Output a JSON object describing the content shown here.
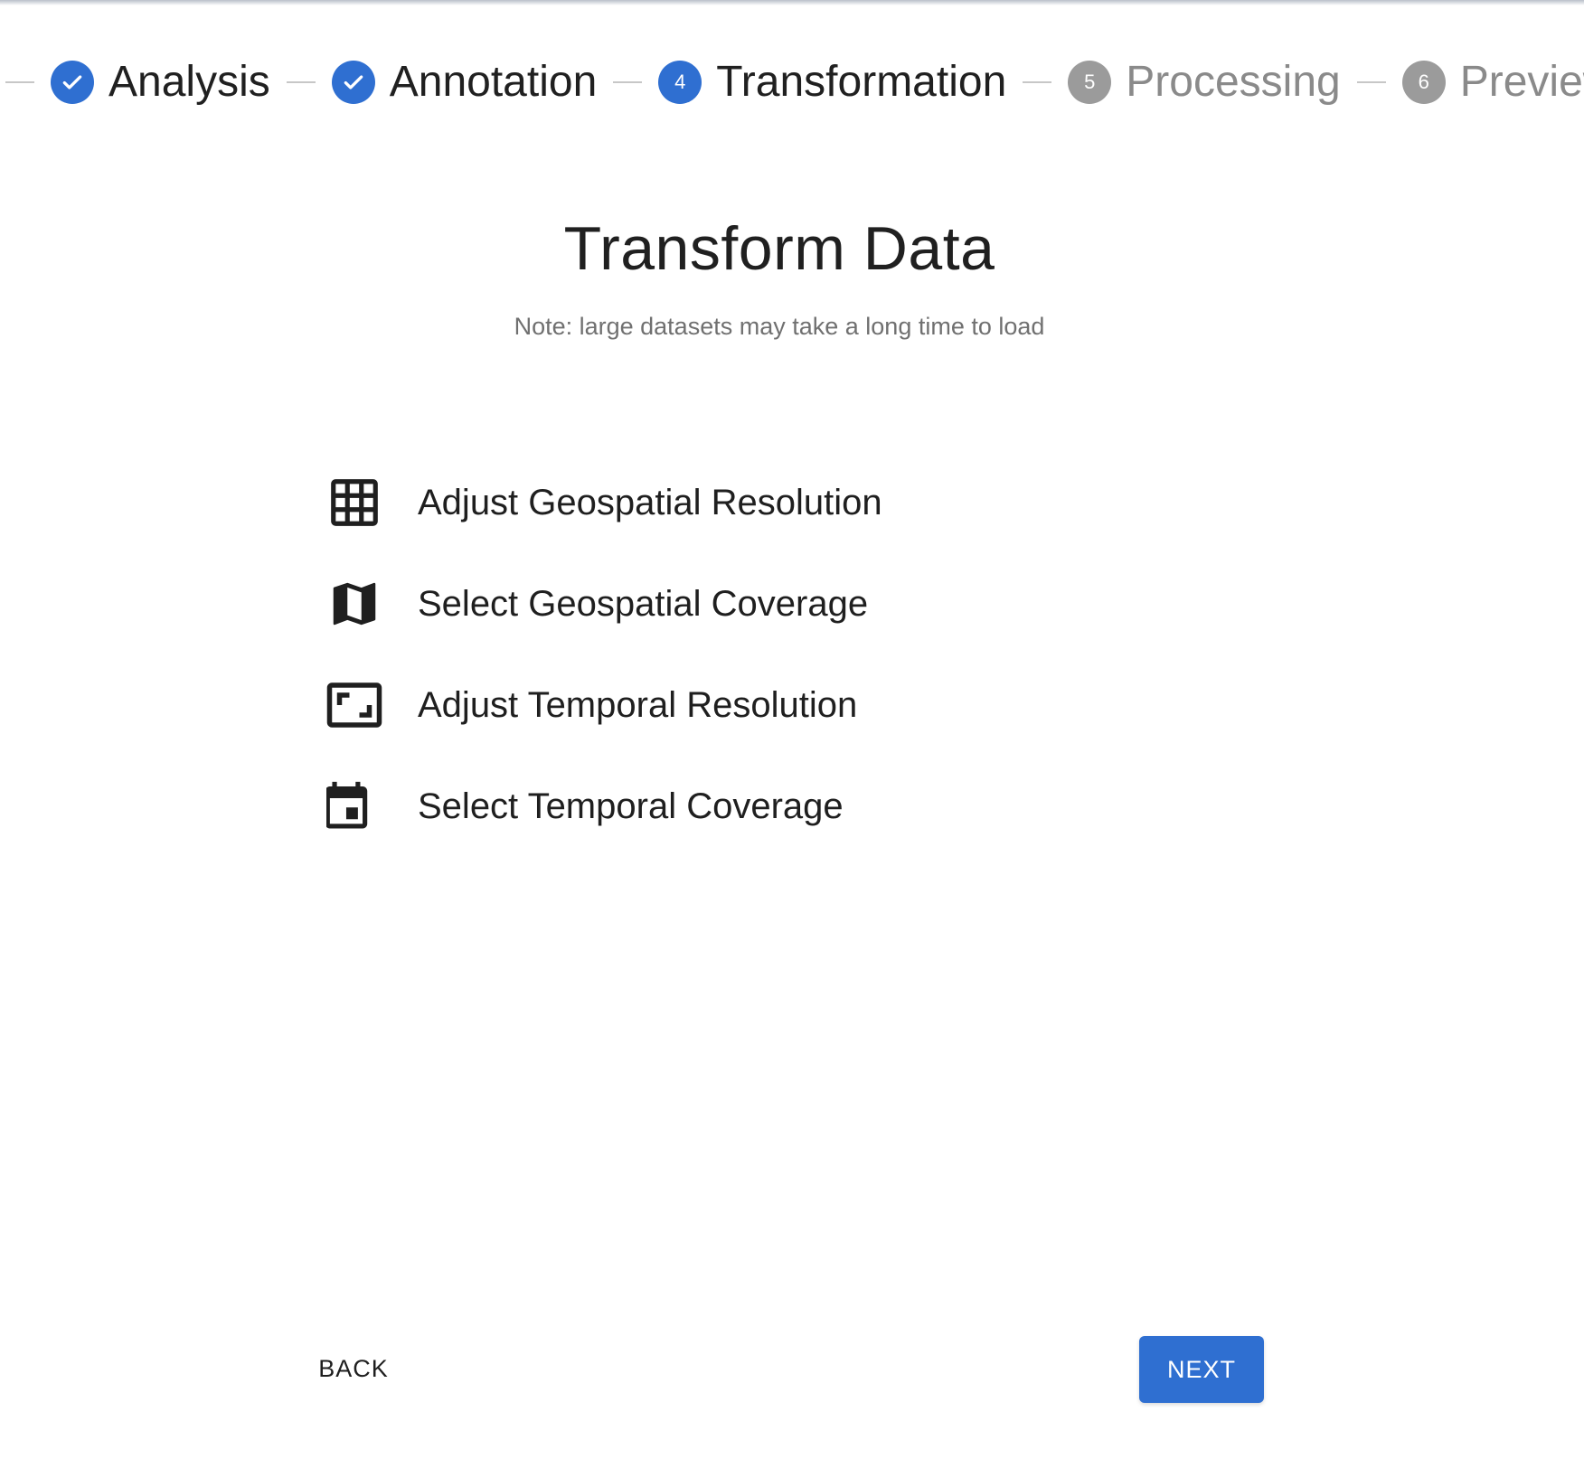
{
  "stepper": {
    "steps": [
      {
        "label": "Analysis",
        "state": "done",
        "icon": "check-circle-icon"
      },
      {
        "label": "Annotation",
        "state": "done",
        "icon": "check-circle-icon"
      },
      {
        "label": "Transformation",
        "state": "active",
        "number": "4"
      },
      {
        "label": "Processing",
        "state": "pending",
        "number": "5"
      },
      {
        "label": "Preview",
        "state": "pending",
        "number": "6"
      }
    ]
  },
  "header": {
    "title": "Transform Data",
    "note": "Note: large datasets may take a long time to load"
  },
  "options": [
    {
      "label": "Adjust Geospatial Resolution",
      "icon": "grid-icon"
    },
    {
      "label": "Select Geospatial Coverage",
      "icon": "map-icon"
    },
    {
      "label": "Adjust Temporal Resolution",
      "icon": "aspect-ratio-icon"
    },
    {
      "label": "Select Temporal Coverage",
      "icon": "calendar-icon"
    }
  ],
  "actions": {
    "back_label": "BACK",
    "next_label": "NEXT"
  },
  "colors": {
    "accent": "#2f6fd1",
    "pending": "#9b9b9b",
    "text": "#1f1f1f",
    "muted": "#707070"
  }
}
